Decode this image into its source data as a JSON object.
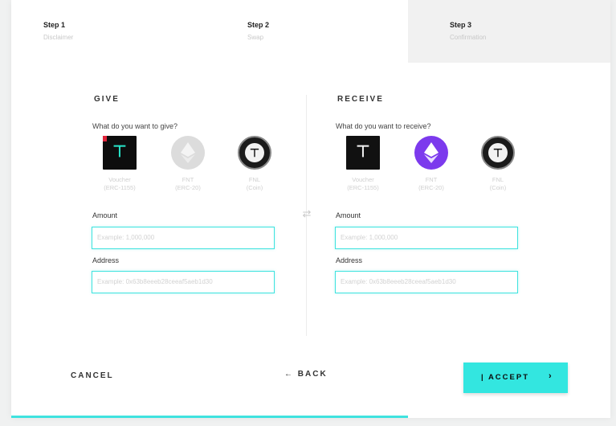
{
  "steps": [
    {
      "title": "Step 1",
      "subtitle": "Disclaimer"
    },
    {
      "title": "Step 2",
      "subtitle": "Swap"
    },
    {
      "title": "Step 3",
      "subtitle": "Confirmation"
    }
  ],
  "active_step": 3,
  "progress_fraction": 0.66,
  "give": {
    "heading": "GIVE",
    "question": "What do you want to give?",
    "tokens": [
      {
        "icon": "voucher-icon",
        "label1": "Voucher",
        "label2": "(ERC-1155)"
      },
      {
        "icon": "ethereum-icon",
        "label1": "FNT",
        "label2": "(ERC-20)"
      },
      {
        "icon": "coin-icon",
        "label1": "FNL",
        "label2": "(Coin)"
      }
    ],
    "amount_label": "Amount",
    "amount_placeholder": "Example: 1,000,000",
    "address_label": "Address",
    "address_placeholder": "Example: 0x63b8eeeb28ceeaf5aeb1d30"
  },
  "receive": {
    "heading": "RECEIVE",
    "question": "What do you want to receive?",
    "tokens": [
      {
        "icon": "voucher-icon",
        "label1": "Voucher",
        "label2": "(ERC-1155)"
      },
      {
        "icon": "ethereum-icon",
        "label1": "FNT",
        "label2": "(ERC-20)"
      },
      {
        "icon": "coin-icon",
        "label1": "FNL",
        "label2": "(Coin)"
      }
    ],
    "amount_label": "Amount",
    "amount_placeholder": "Example: 1,000,000",
    "address_label": "Address",
    "address_placeholder": "Example: 0x63b8eeeb28ceeaf5aeb1d30"
  },
  "swap_icon": "swap-arrows-icon",
  "actions": {
    "cancel": "CANCEL",
    "back": "← BACK",
    "accept": "| ACCEPT",
    "accept_chevron": "›"
  },
  "colors": {
    "accent": "#33e6e0",
    "eth_active": "#7c3aed",
    "voucher_bg": "#0d0d0d"
  }
}
